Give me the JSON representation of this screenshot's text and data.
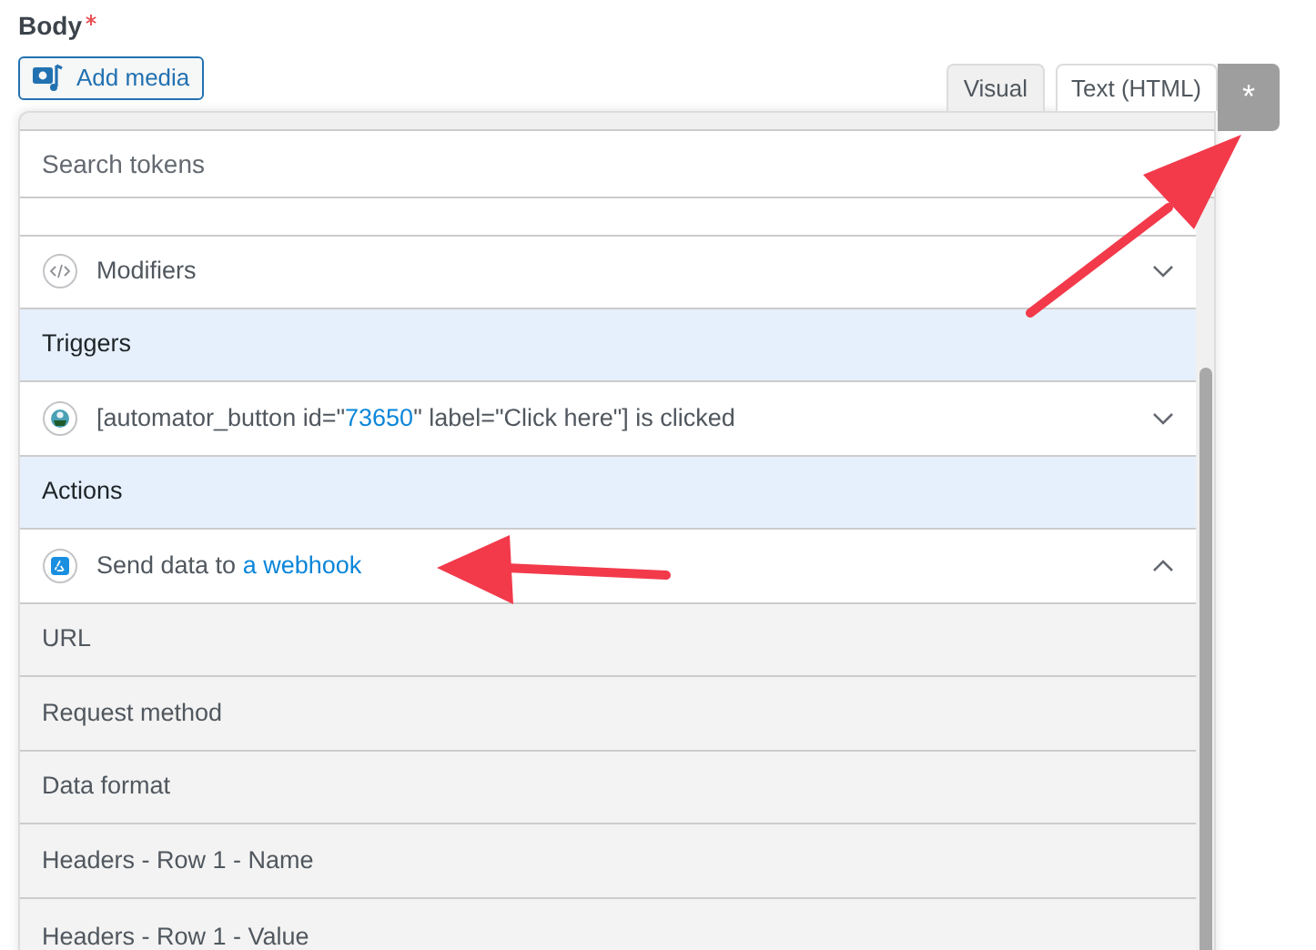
{
  "field": {
    "label": "Body",
    "required": true
  },
  "add_media": {
    "label": "Add media"
  },
  "editor_tabs": [
    {
      "label": "Visual",
      "selected": true
    },
    {
      "label": "Text (HTML)",
      "selected": false
    }
  ],
  "token_button": {
    "label": "*"
  },
  "token_search": {
    "placeholder": "Search tokens"
  },
  "token_rows": [
    {
      "kind": "modifiers",
      "parts": [
        {
          "text": "Modifiers",
          "kind": "plain"
        }
      ],
      "expanded": false
    },
    {
      "kind": "section",
      "parts": [
        {
          "text": "Triggers",
          "kind": "plain"
        }
      ]
    },
    {
      "kind": "trigger",
      "parts": [
        {
          "text": "[automator_button id=\"",
          "kind": "plain"
        },
        {
          "text": "73650",
          "kind": "link"
        },
        {
          "text": "\" label=\"Click here\"] is clicked",
          "kind": "plain"
        }
      ],
      "expanded": false
    },
    {
      "kind": "section",
      "parts": [
        {
          "text": "Actions",
          "kind": "plain"
        }
      ]
    },
    {
      "kind": "action",
      "parts": [
        {
          "text": "Send data to ",
          "kind": "plain"
        },
        {
          "text": "a webhook",
          "kind": "link"
        }
      ],
      "expanded": true
    },
    {
      "kind": "field",
      "parts": [
        {
          "text": "URL",
          "kind": "plain"
        }
      ]
    },
    {
      "kind": "field",
      "parts": [
        {
          "text": "Request method",
          "kind": "plain"
        }
      ]
    },
    {
      "kind": "field",
      "parts": [
        {
          "text": "Data format",
          "kind": "plain"
        }
      ]
    },
    {
      "kind": "field",
      "parts": [
        {
          "text": "Headers - Row 1 - Name",
          "kind": "plain"
        }
      ]
    },
    {
      "kind": "field",
      "parts": [
        {
          "text": "Headers - Row 1 - Value",
          "kind": "plain"
        }
      ]
    }
  ]
}
